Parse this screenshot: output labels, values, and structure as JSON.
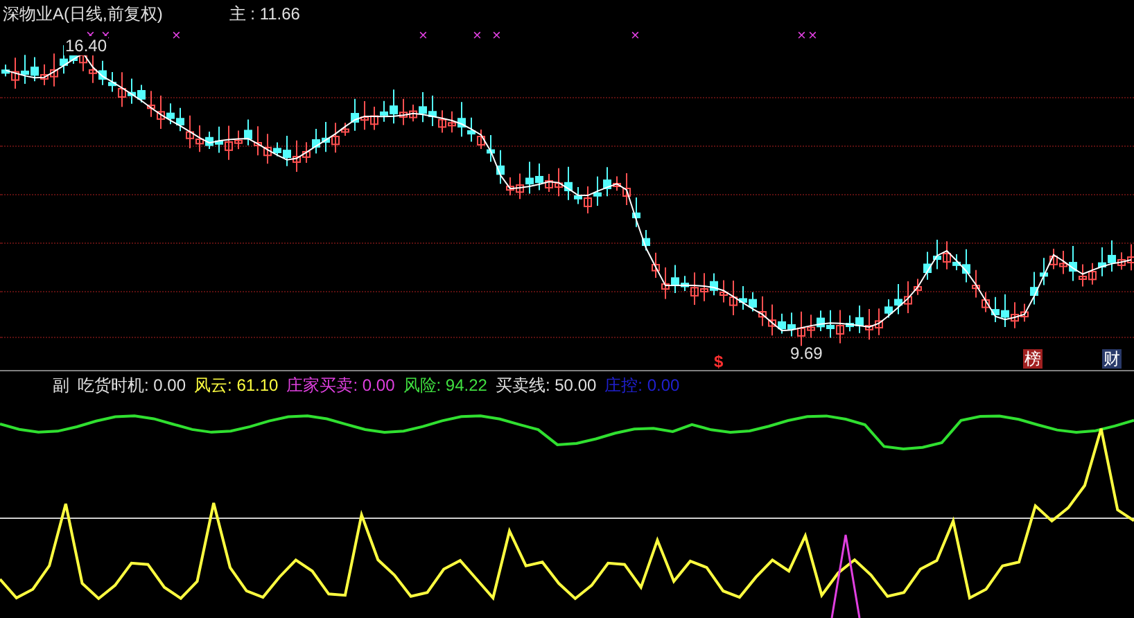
{
  "main_chart": {
    "title": "深物业A(日线,前复权)",
    "main_label": "主 : 11.66",
    "high_label": "16.40",
    "low_label": "9.69",
    "signal_marks": [
      "×",
      "×",
      "×",
      "×",
      "×",
      "×",
      "×",
      "×",
      "×"
    ],
    "bottom_marks": [
      {
        "text": "$",
        "kind": "plain"
      },
      {
        "text": "榜",
        "kind": "badge",
        "color": "#a02020"
      },
      {
        "text": "财",
        "kind": "badge",
        "color": "#2a3a6a"
      }
    ]
  },
  "indicator": {
    "legend": [
      {
        "text": "副",
        "color": "#e0e0e0"
      },
      {
        "text": "吃货时机: 0.00",
        "color": "#e0e0e0"
      },
      {
        "text": "风云: 61.10",
        "color": "#ffff40"
      },
      {
        "text": "庄家买卖: 0.00",
        "color": "#e040e0"
      },
      {
        "text": "风险: 94.22",
        "color": "#40e040"
      },
      {
        "text": "买卖线: 50.00",
        "color": "#e0e0e0"
      },
      {
        "text": "庄控: 0.00",
        "color": "#2020d0"
      }
    ]
  }
}
